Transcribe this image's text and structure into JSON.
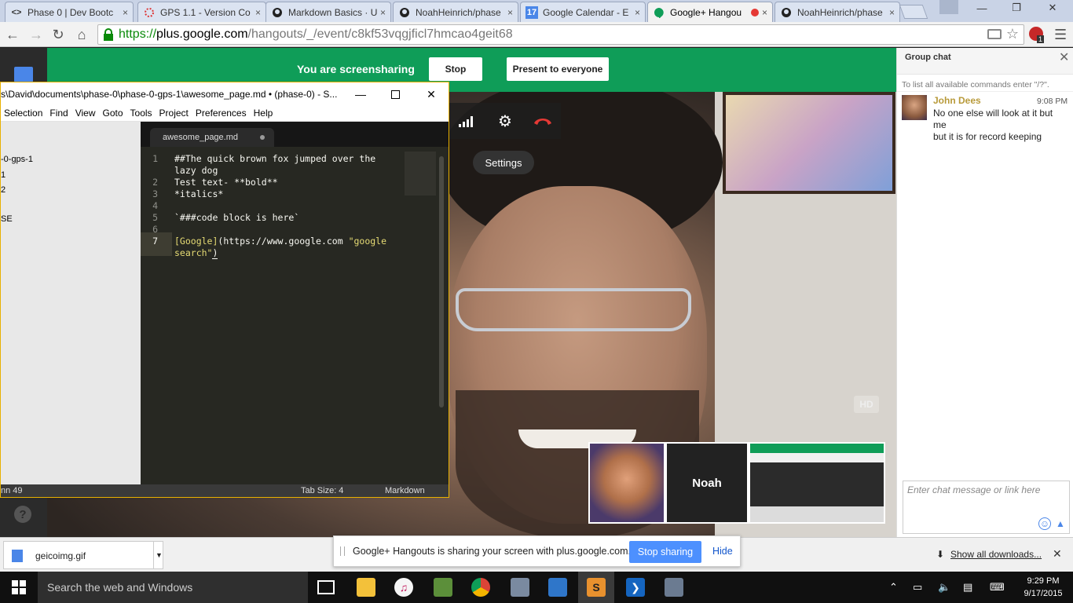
{
  "browser": {
    "tabs": [
      {
        "label": "Phase 0 | Dev Bootc",
        "icon": "code-icon",
        "active": false
      },
      {
        "label": "GPS 1.1 - Version Co",
        "icon": "loading-icon",
        "active": false
      },
      {
        "label": "Markdown Basics · U",
        "icon": "github-icon",
        "active": false
      },
      {
        "label": "NoahHeinrich/phase",
        "icon": "github-icon",
        "active": false
      },
      {
        "label": "Google Calendar - E",
        "icon": "calendar-icon",
        "active": false
      },
      {
        "label": "Google+ Hangou",
        "icon": "hangouts-icon",
        "active": true
      },
      {
        "label": "NoahHeinrich/phase",
        "icon": "github-icon",
        "active": false
      }
    ],
    "calendar_day": "17",
    "tab_close": "×",
    "url": {
      "scheme": "https://",
      "host": "plus.google.com",
      "path": "/hangouts/_/event/c8kf53vqgjficl7hmcao4geit68"
    },
    "extension_badge": "1",
    "window_controls": {
      "minimize": "—",
      "restore": "❐",
      "close": "✕"
    }
  },
  "hangout": {
    "share_status": "You are screensharing",
    "stop_label": "Stop",
    "present_label": "Present to everyone",
    "settings_tooltip": "Settings",
    "hd_label": "HD",
    "help_label": "?",
    "participants": [
      {
        "name": "",
        "type": "video"
      },
      {
        "name": "Noah",
        "type": "placeholder"
      },
      {
        "name": "",
        "type": "screenshare"
      }
    ],
    "accent_color": "#0f9d58"
  },
  "editor": {
    "title": "s\\David\\documents\\phase-0\\phase-0-gps-1\\awesome_page.md • (phase-0) - S...",
    "menu": [
      "Selection",
      "Find",
      "View",
      "Goto",
      "Tools",
      "Project",
      "Preferences",
      "Help"
    ],
    "sidebar_items": [
      "-0-gps-1",
      "1",
      "2",
      "SE"
    ],
    "tab_label": "awesome_page.md",
    "lines": [
      {
        "num": "1",
        "text": "##The quick brown fox jumped over the"
      },
      {
        "num": "",
        "text": "lazy dog"
      },
      {
        "num": "2",
        "text": "Test text- **bold**"
      },
      {
        "num": "3",
        "text": "*italics*"
      },
      {
        "num": "4",
        "text": ""
      },
      {
        "num": "5",
        "text": "`###code block is here`"
      },
      {
        "num": "6",
        "text": ""
      },
      {
        "num": "7",
        "text_link": "[Google]",
        "text_url": "(https://www.google.com ",
        "text_str": "\"google"
      },
      {
        "num": "",
        "text_str": "search\"",
        "text_end": ")"
      }
    ],
    "status_left": "nn 49",
    "status_tab": "Tab Size: 4",
    "status_syntax": "Markdown"
  },
  "chat": {
    "title": "Group chat",
    "close": "✕",
    "hint": "To list all available commands enter \"/?\".",
    "messages": [
      {
        "author": "John Dees",
        "time": "9:08 PM",
        "lines": [
          "No one else will look at it but me",
          "but it is for record keeping"
        ]
      }
    ],
    "input_placeholder": "Enter chat message or link here"
  },
  "download_bar": {
    "file_name": "geicoimg.gif",
    "share_message": "Google+ Hangouts is sharing your screen with plus.google.com.",
    "stop_sharing_label": "Stop sharing",
    "hide_label": "Hide",
    "show_all_label": "Show all downloads...",
    "close": "✕"
  },
  "taskbar": {
    "search_placeholder": "Search the web and Windows",
    "time": "9:29 PM",
    "date": "9/17/2015"
  }
}
